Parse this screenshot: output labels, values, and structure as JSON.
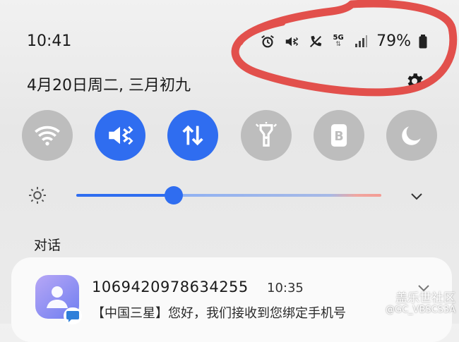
{
  "status_bar": {
    "time": "10:41",
    "battery": "79%",
    "network": "5G",
    "icons": [
      "alarm-icon",
      "vibrate-icon",
      "no-call-icon",
      "5g-icon",
      "signal-icon",
      "battery-icon"
    ]
  },
  "panel": {
    "date": "4月20日周二, 三月初九"
  },
  "quick_toggles": [
    {
      "name": "wifi-icon",
      "active": false
    },
    {
      "name": "vibrate-icon",
      "active": true
    },
    {
      "name": "mobile-data-icon",
      "active": true
    },
    {
      "name": "flashlight-icon",
      "active": false
    },
    {
      "name": "bixby-icon",
      "active": false
    },
    {
      "name": "night-mode-icon",
      "active": false
    }
  ],
  "brightness": {
    "level": 0.32
  },
  "notifications": {
    "section_label": "对话",
    "items": [
      {
        "sender": "1069420978634255",
        "time": "10:35",
        "body": "【中国三星】您好，我们接收到您绑定手机号"
      }
    ]
  },
  "watermark": {
    "line1": "盖乐世社区",
    "line2": "@GC_VBSCS3A"
  },
  "colors": {
    "accent": "#2f6df0",
    "toggle_off": "#bdbdbd",
    "annotation": "#e2504c"
  }
}
